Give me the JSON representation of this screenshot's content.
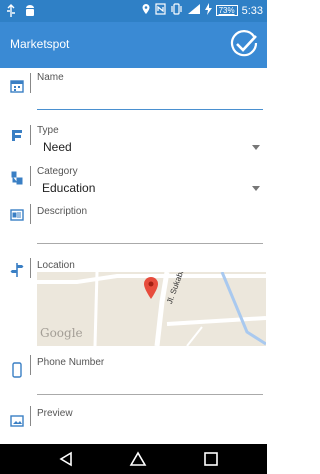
{
  "statusbar": {
    "time": "5:33",
    "battery": "73%",
    "icons": [
      "usb-icon",
      "android-icon",
      "location-icon",
      "nfc-icon",
      "vibrate-icon",
      "signal-icon",
      "charging-icon"
    ]
  },
  "appbar": {
    "title": "Marketspot",
    "confirm_icon": "check-circle-icon"
  },
  "form": {
    "name_label": "Name",
    "name_value": "",
    "type_label": "Type",
    "type_value": "Need",
    "category_label": "Category",
    "category_value": "Education",
    "description_label": "Description",
    "description_value": "",
    "location_label": "Location",
    "phone_label": "Phone Number",
    "phone_value": "",
    "preview_label": "Preview"
  },
  "map": {
    "watermark": "Google",
    "street": "Jl. Sukabir"
  },
  "navbar": {
    "icons": [
      "back-icon",
      "home-icon",
      "recents-icon"
    ]
  },
  "colors": {
    "statusbar": "#2f80c6",
    "appbar": "#3a8ad4",
    "field_icon": "#3a7fc4",
    "marker": "#e74c3c"
  }
}
